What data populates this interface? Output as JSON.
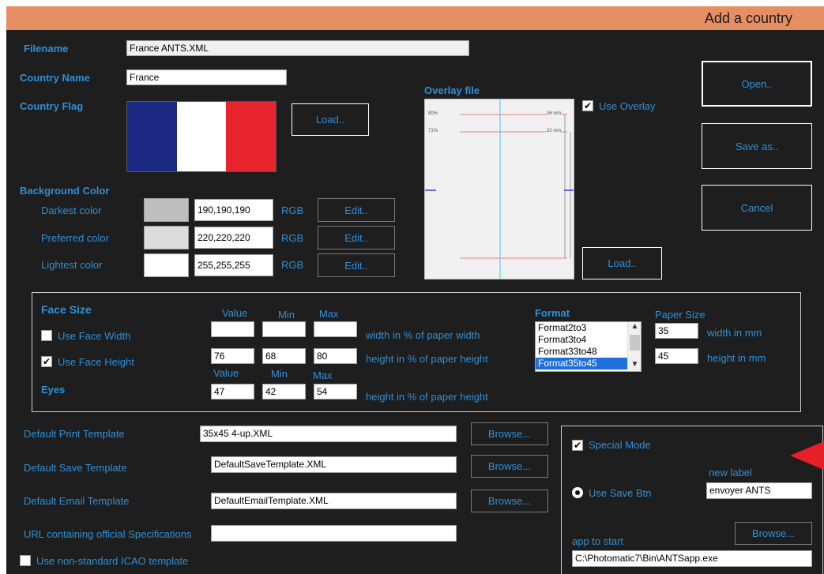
{
  "window": {
    "title": "Add a country"
  },
  "form": {
    "filename_label": "Filename",
    "filename_value": "France ANTS.XML",
    "country_name_label": "Country Name",
    "country_name_value": "France",
    "country_flag_label": "Country Flag",
    "flag_load_label": "Load..",
    "flag_colors": [
      "#1d2a83",
      "#ffffff",
      "#e8252f"
    ]
  },
  "background": {
    "header": "Background Color",
    "rows": [
      {
        "label": "Darkest color",
        "value": "190,190,190",
        "rgb": "RGB",
        "edit": "Edit..",
        "swatch": "#bebebe"
      },
      {
        "label": "Preferred color",
        "value": "220,220,220",
        "rgb": "RGB",
        "edit": "Edit..",
        "swatch": "#dcdcdc"
      },
      {
        "label": "Lightest color",
        "value": "255,255,255",
        "rgb": "RGB",
        "edit": "Edit..",
        "swatch": "#ffffff"
      }
    ]
  },
  "overlay": {
    "label": "Overlay file",
    "use_overlay_label": "Use Overlay",
    "use_overlay_checked": true,
    "load_label": "Load..",
    "preview": {
      "p1": "80%",
      "p2": "71%",
      "m1": "36 mm",
      "m2": "32 mm"
    }
  },
  "actions": {
    "open": "Open..",
    "save_as": "Save as..",
    "cancel": "Cancel"
  },
  "face": {
    "header": "Face Size",
    "col_value": "Value",
    "col_min": "Min",
    "col_max": "Max",
    "use_width_label": "Use Face Width",
    "use_width_checked": false,
    "width_value": "",
    "width_min": "",
    "width_max": "",
    "width_desc": "width in % of paper width",
    "use_height_label": "Use Face Height",
    "use_height_checked": true,
    "height_value": "76",
    "height_min": "68",
    "height_max": "80",
    "height_desc": "height in % of paper height",
    "eyes_label": "Eyes",
    "eyes_value": "47",
    "eyes_min": "42",
    "eyes_max": "54",
    "eyes_desc": "height in % of paper height",
    "format_label": "Format",
    "format_options": [
      "Format2to3",
      "Format3to4",
      "Format33to48",
      "Format35to45"
    ],
    "format_selected": "Format35to45",
    "paper_size_label": "Paper Size",
    "paper_width": "35",
    "paper_width_desc": "width in mm",
    "paper_height": "45",
    "paper_height_desc": "height in mm"
  },
  "templates": {
    "print_label": "Default Print Template",
    "print_value": "35x45 4-up.XML",
    "save_label": "Default Save Template",
    "save_value": "DefaultSaveTemplate.XML",
    "email_label": "Default Email Template",
    "email_value": "DefaultEmailTemplate.XML",
    "url_label": "URL containing official Specifications",
    "url_value": "",
    "browse_label": "Browse...",
    "non_standard_label": "Use non-standard ICAO template",
    "non_standard_checked": false
  },
  "special": {
    "special_mode_label": "Special Mode",
    "special_mode_checked": true,
    "new_label_header": "new label",
    "use_save_btn_label": "Use Save Btn",
    "new_label_value": "envoyer ANTS",
    "app_to_start_label": "app to start",
    "browse_label": "Browse...",
    "app_path": "C:\\Photomatic7\\Bin\\ANTSapp.exe"
  },
  "colors": {
    "accent": "#2f8fd6",
    "titlebar": "#e58f63",
    "background": "#1e1e1e",
    "arrow": "#e8202a"
  }
}
